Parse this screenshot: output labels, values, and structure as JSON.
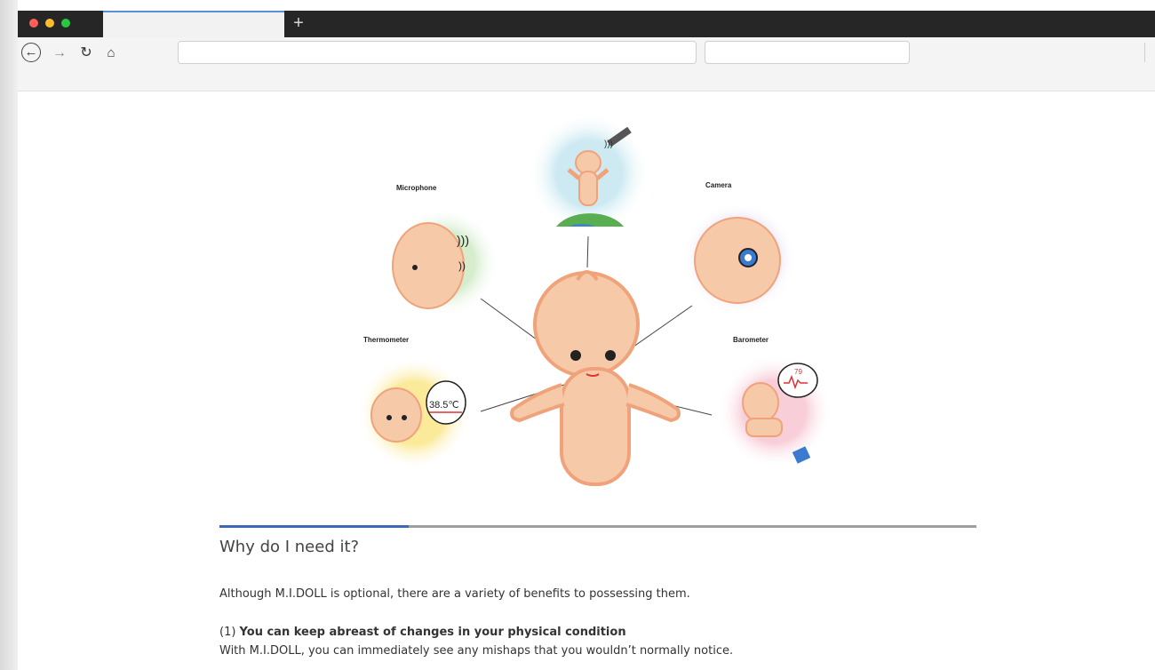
{
  "browser": {
    "new_tab_label": "+",
    "nav": {
      "back": "←",
      "forward": "→",
      "reload": "↻",
      "home": "⌂"
    },
    "url_value": "",
    "search_value": ""
  },
  "illustration": {
    "labels": {
      "microphone": "Microphone",
      "camera": "Camera",
      "thermometer": "Thermometer",
      "barometer": "Barometer"
    },
    "thermometer_reading": "38.5℃",
    "heart_rate": "79"
  },
  "progress": {
    "fraction": 0.25
  },
  "article": {
    "heading": "Why do I need it?",
    "intro": "Although M.I.DOLL is optional, there are a variety of benefits to possessing them.",
    "point1_number": "(1) ",
    "point1_title": "You can keep abreast of changes in your physical condition",
    "point1_body": "With M.I.DOLL, you can immediately see any mishaps that you wouldn’t normally notice."
  },
  "colors": {
    "progress_fill": "#3d67b8",
    "progress_track": "#9e9e9e",
    "tab_bar": "#262626",
    "skin": "#f6c9a8",
    "outline": "#f0a37a"
  }
}
